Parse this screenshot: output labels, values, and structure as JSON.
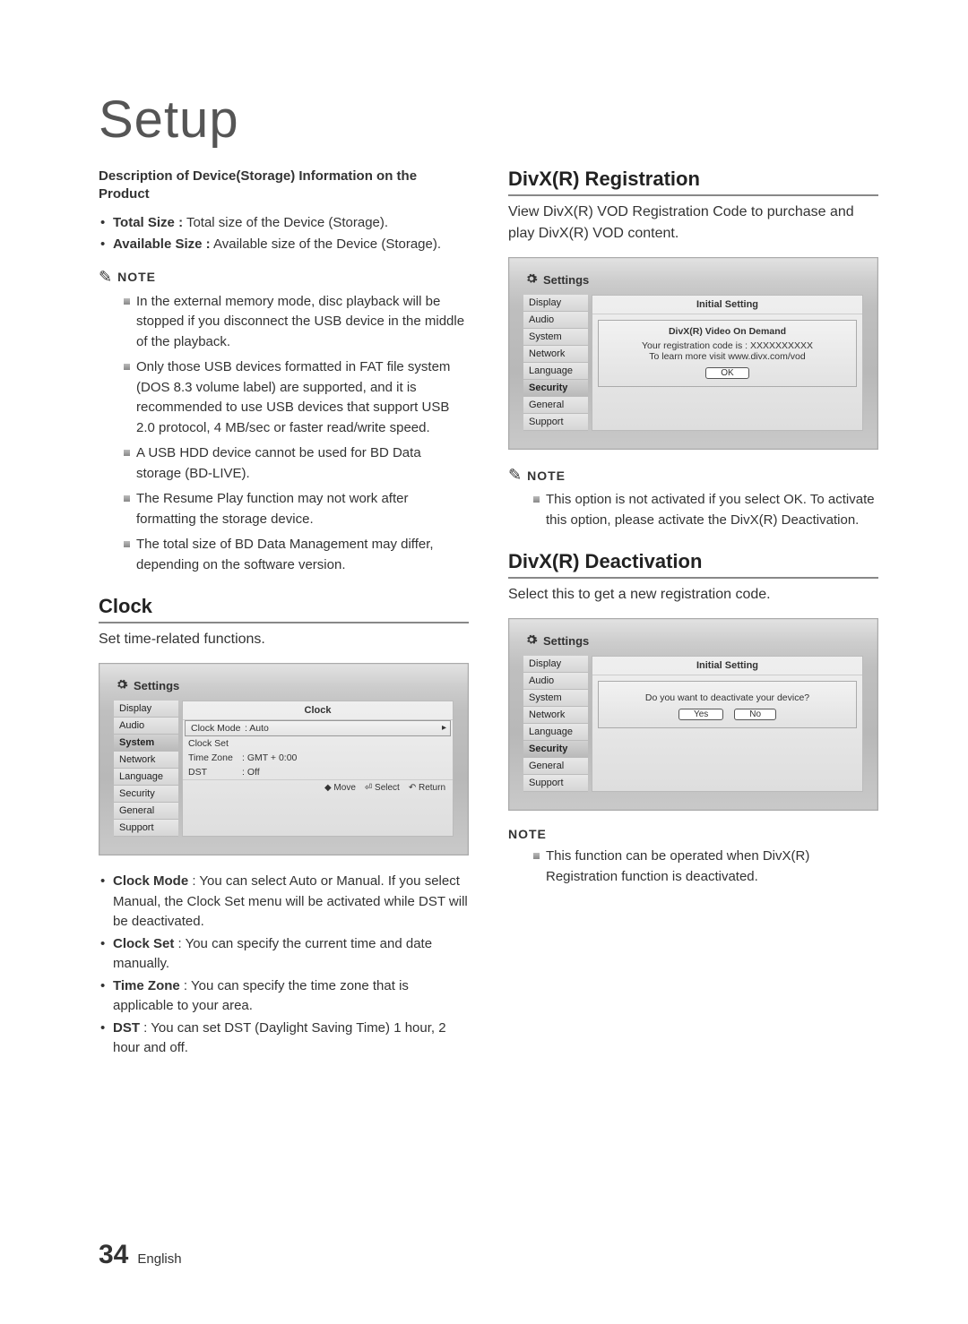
{
  "page": {
    "title": "Setup",
    "number": "34",
    "language": "English"
  },
  "left": {
    "storage_heading": "Description of Device(Storage) Information on the Product",
    "storage_items": [
      {
        "term": "Total Size :",
        "desc": " Total size of the Device (Storage)."
      },
      {
        "term": "Available Size :",
        "desc": " Available size of the Device (Storage)."
      }
    ],
    "note_label": "NOTE",
    "notes": [
      "In the external memory mode, disc playback will be stopped if you disconnect the USB device in the middle of the playback.",
      "Only those USB devices formatted in FAT file system (DOS 8.3 volume label) are supported, and it is recommended to use USB devices that support USB 2.0 protocol, 4 MB/sec or faster read/write speed.",
      "A USB HDD device cannot be used for BD Data storage (BD-LIVE).",
      "The Resume Play function may not work after formatting the storage device.",
      "The total size of BD Data Management may differ, depending on the software version."
    ],
    "clock_heading": "Clock",
    "clock_body": "Set time-related functions.",
    "clock_osd": {
      "header": "Settings",
      "side": [
        "Display",
        "Audio",
        "System",
        "Network",
        "Language",
        "Security",
        "General",
        "Support"
      ],
      "panel_title": "Clock",
      "rows": [
        {
          "k": "Clock Mode",
          "v": ": Auto",
          "sel": true
        },
        {
          "k": "Clock Set",
          "v": ""
        },
        {
          "k": "Time Zone",
          "v": ": GMT + 0:00"
        },
        {
          "k": "DST",
          "v": ": Off"
        }
      ],
      "foot": [
        "◆ Move",
        "⏎ Select",
        "↶ Return"
      ]
    },
    "clock_items": [
      {
        "term": "Clock Mode",
        "desc": " : You can select Auto or Manual. If you select Manual, the Clock Set menu will be activated while DST will be deactivated."
      },
      {
        "term": "Clock Set",
        "desc": " : You can specify the current time and date manually."
      },
      {
        "term": "Time Zone",
        "desc": " : You can specify the time zone that is applicable to your area."
      },
      {
        "term": "DST",
        "desc": " : You can set DST (Daylight Saving Time) 1 hour, 2 hour and off."
      }
    ]
  },
  "right": {
    "reg_heading": "DivX(R) Registration",
    "reg_body": "View DivX(R) VOD Registration Code to purchase and play DivX(R) VOD content.",
    "reg_osd": {
      "header": "Settings",
      "side": [
        "Display",
        "Audio",
        "System",
        "Network",
        "Language",
        "Security",
        "General",
        "Support"
      ],
      "panel_title": "Initial Setting",
      "dialog_title": "DivX(R) Video On Demand",
      "dialog_line1": "Your registration code is : XXXXXXXXXX",
      "dialog_line2": "To learn more visit www.divx.com/vod",
      "ok": "OK"
    },
    "reg_note_label": "NOTE",
    "reg_notes": [
      "This option is not activated if you select OK. To activate this option, please activate the DivX(R) Deactivation."
    ],
    "deact_heading": "DivX(R) Deactivation",
    "deact_body": "Select this to get a new registration code.",
    "deact_osd": {
      "header": "Settings",
      "side": [
        "Display",
        "Audio",
        "System",
        "Network",
        "Language",
        "Security",
        "General",
        "Support"
      ],
      "panel_title": "Initial Setting",
      "dialog_text": "Do you want to deactivate your device?",
      "yes": "Yes",
      "no": "No"
    },
    "deact_note_label": "NOTE",
    "deact_notes": [
      "This function can be operated when DivX(R) Registration function is deactivated."
    ]
  }
}
